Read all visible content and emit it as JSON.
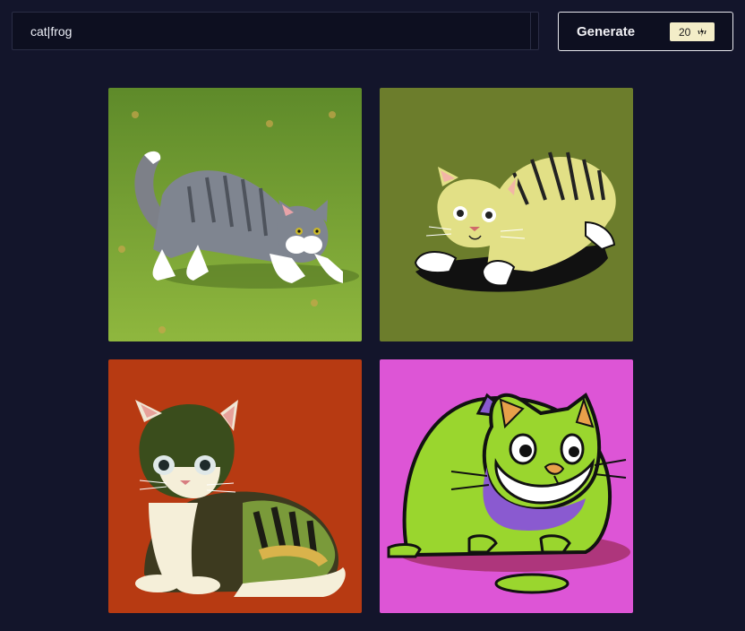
{
  "prompt": {
    "value": "cat|frog"
  },
  "generate_button": {
    "label": "Generate",
    "credits": "20",
    "credits_icon": "bolt-icon"
  },
  "results": [
    {
      "alt": "gray tabby cat crouching on green grass",
      "background": "#6f9b2e"
    },
    {
      "alt": "yellow tiger-striped cat on olive background",
      "background": "#6c7d2c"
    },
    {
      "alt": "green and black tabby cat on red background",
      "background": "#b73a12"
    },
    {
      "alt": "green cartoon cat on pink background",
      "background": "#dd55d6"
    }
  ],
  "colors": {
    "background": "#13152b",
    "input_bg": "#0d0f20",
    "badge_bg": "#f3edc8"
  }
}
